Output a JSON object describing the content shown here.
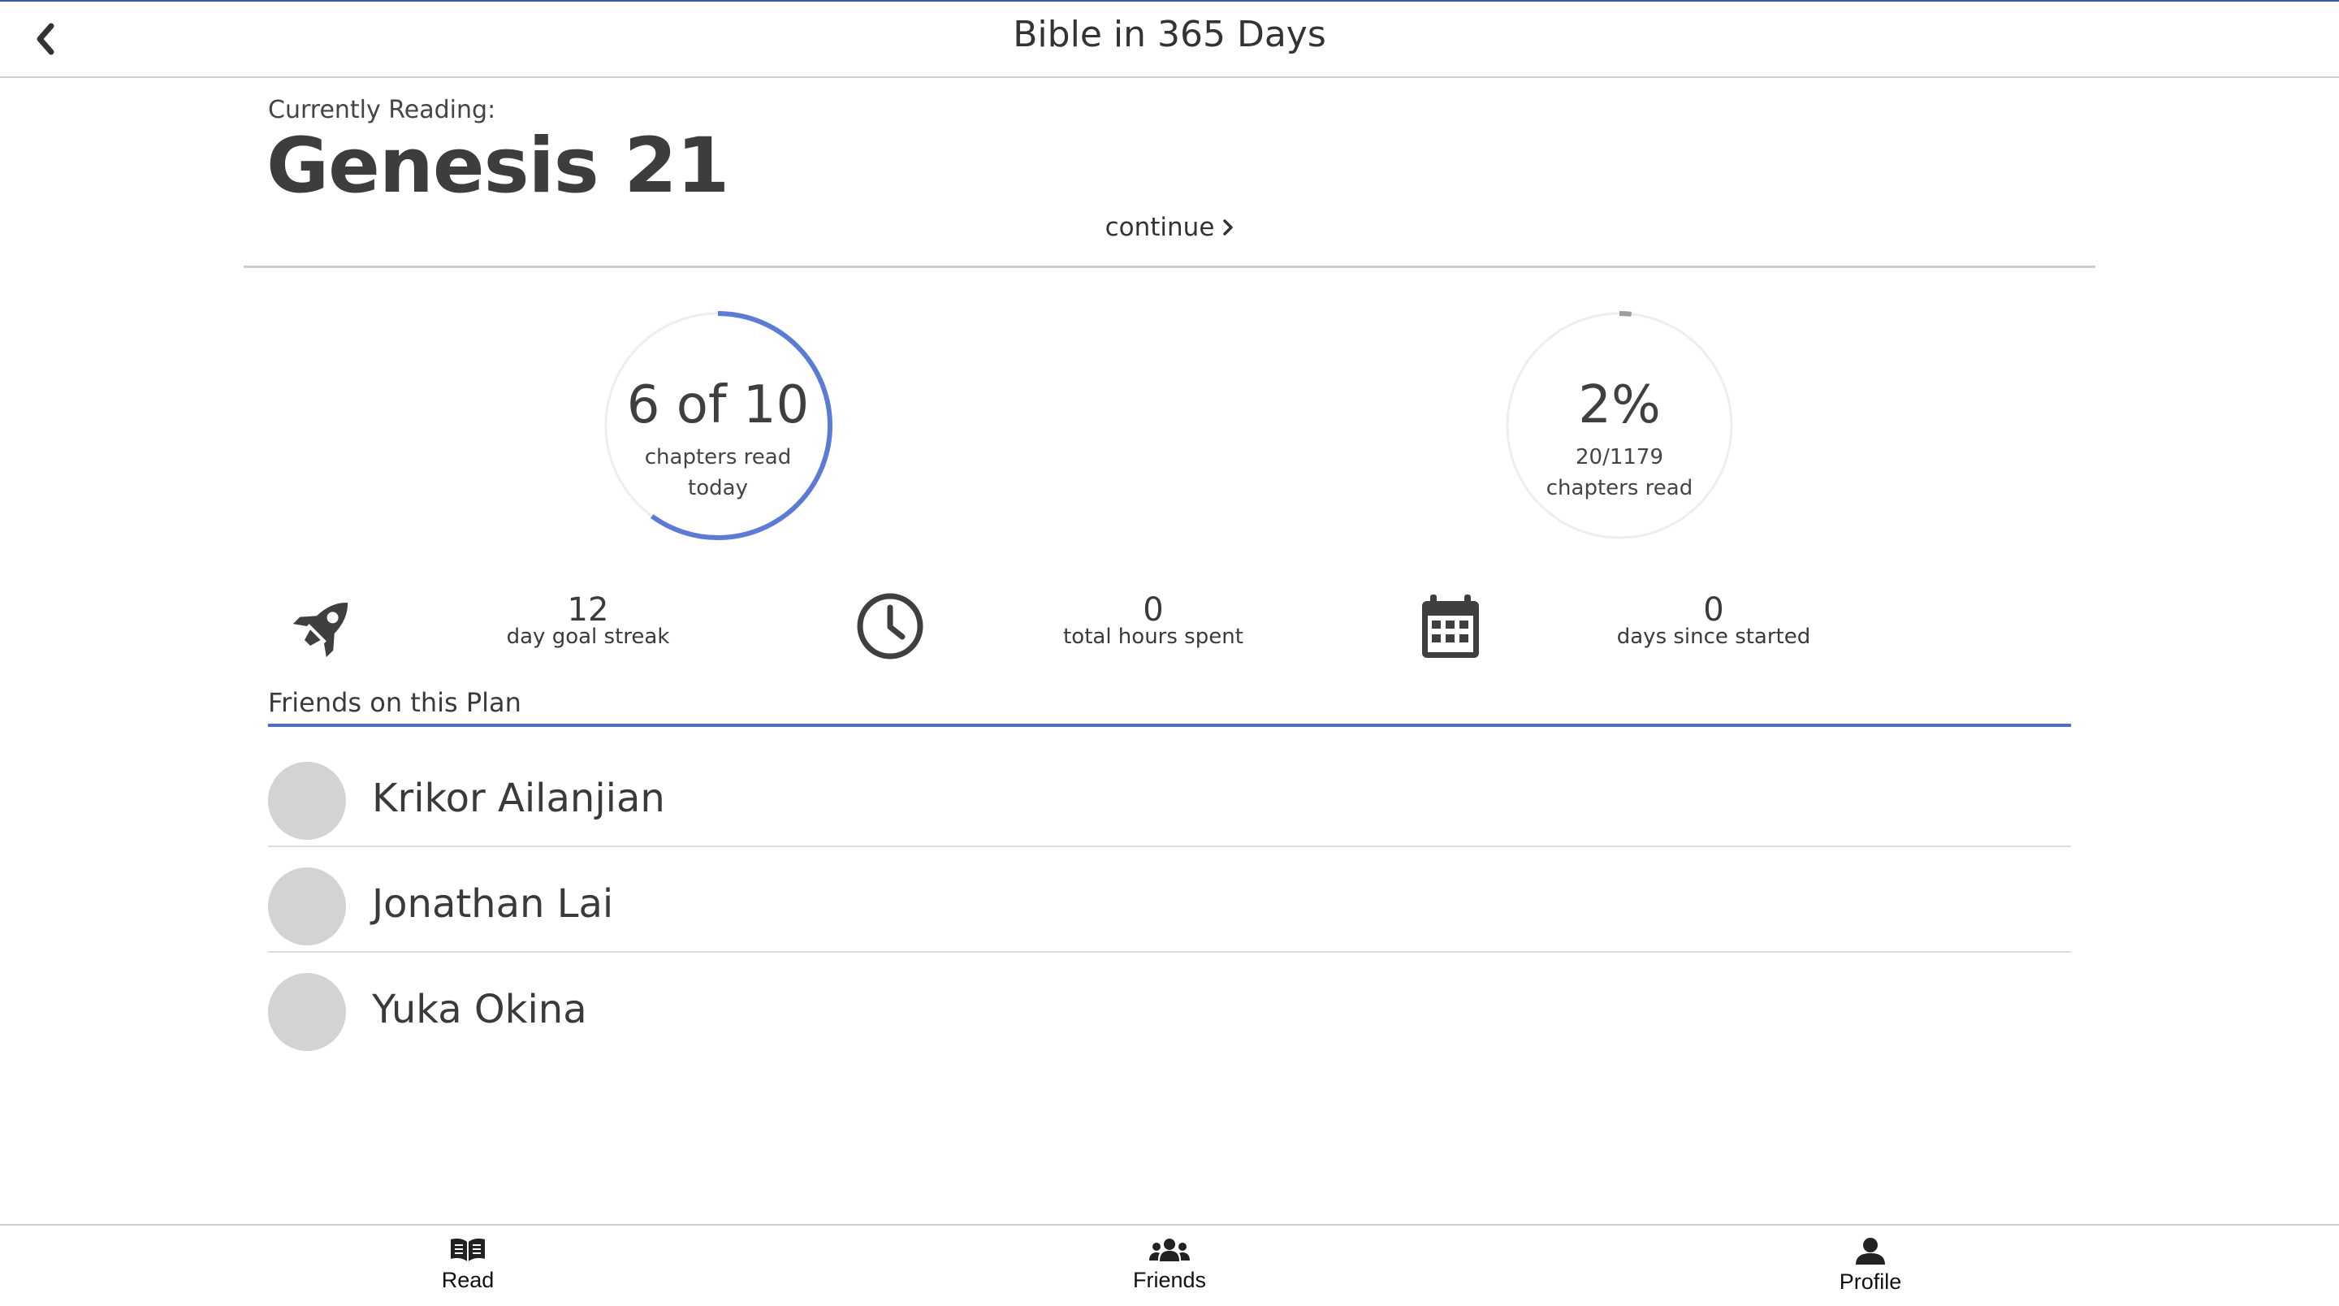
{
  "header": {
    "title": "Bible in 365 Days",
    "back_icon": "chevron-left-icon"
  },
  "reading": {
    "label": "Currently Reading:",
    "title": "Genesis 21",
    "continue_label": "continue"
  },
  "progress": {
    "today": {
      "value": "6 of 10",
      "line1": "chapters read",
      "line2": "today",
      "fraction": 0.6,
      "color": "#5b7bd5"
    },
    "overall": {
      "value": "2%",
      "line1": "20/1179",
      "line2": "chapters read",
      "fraction": 0.017,
      "color": "#9e9e9e"
    }
  },
  "stats": [
    {
      "icon": "rocket-icon",
      "value": "12",
      "label": "day goal streak"
    },
    {
      "icon": "clock-icon",
      "value": "0",
      "label": "total hours spent"
    },
    {
      "icon": "calendar-icon",
      "value": "0",
      "label": "days since started"
    }
  ],
  "friends": {
    "heading": "Friends on this Plan",
    "accent": "#4a6fcf",
    "list": [
      {
        "name": "Krikor Ailanjian"
      },
      {
        "name": "Jonathan Lai"
      },
      {
        "name": "Yuka Okina"
      }
    ]
  },
  "tabs": [
    {
      "icon": "book-open-icon",
      "label": "Read"
    },
    {
      "icon": "users-icon",
      "label": "Friends"
    },
    {
      "icon": "user-icon",
      "label": "Profile"
    }
  ]
}
